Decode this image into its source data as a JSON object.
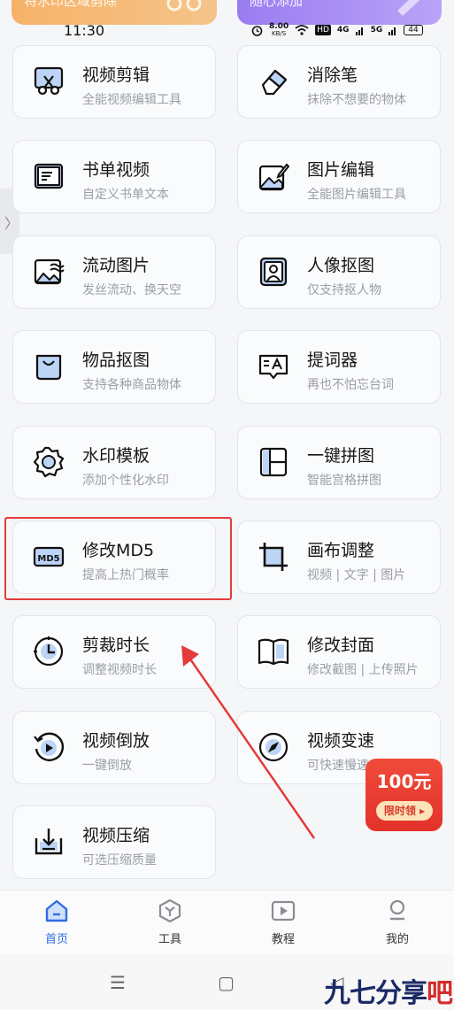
{
  "banners": {
    "left_text": "将水印区域剪除",
    "right_text": "随心添加"
  },
  "status_bar": {
    "time": "11:30",
    "speed_value": "8.00",
    "speed_unit": "KB/S",
    "hd": "HD",
    "signal_1": "4G",
    "signal_2": "5G",
    "battery": "44"
  },
  "side_handle": {
    "glyph": "〉"
  },
  "tools": [
    {
      "title": "视频剪辑",
      "subtitle": "全能视频编辑工具",
      "icon": "scissors-icon"
    },
    {
      "title": "消除笔",
      "subtitle": "抹除不想要的物体",
      "icon": "eraser-icon"
    },
    {
      "title": "书单视频",
      "subtitle": "自定义书单文本",
      "icon": "book-icon"
    },
    {
      "title": "图片编辑",
      "subtitle": "全能图片编辑工具",
      "icon": "image-edit-icon"
    },
    {
      "title": "流动图片",
      "subtitle": "发丝流动、换天空",
      "icon": "flowing-image-icon"
    },
    {
      "title": "人像抠图",
      "subtitle": "仅支持抠人物",
      "icon": "portrait-icon"
    },
    {
      "title": "物品抠图",
      "subtitle": "支持各种商品物体",
      "icon": "bag-icon"
    },
    {
      "title": "提词器",
      "subtitle": "再也不怕忘台词",
      "icon": "teleprompter-icon"
    },
    {
      "title": "水印模板",
      "subtitle": "添加个性化水印",
      "icon": "watermark-gear-icon"
    },
    {
      "title": "一键拼图",
      "subtitle": "智能宫格拼图",
      "icon": "collage-icon"
    },
    {
      "title": "修改MD5",
      "subtitle": "提高上热门概率",
      "icon": "md5-icon",
      "icon_text": "MD5"
    },
    {
      "title": "画布调整",
      "subtitle": "视频 | 文字 | 图片",
      "icon": "crop-icon"
    },
    {
      "title": "剪裁时长",
      "subtitle": "调整视频时长",
      "icon": "clock-icon"
    },
    {
      "title": "修改封面",
      "subtitle": "修改截图 | 上传照片",
      "icon": "cover-book-icon"
    },
    {
      "title": "视频倒放",
      "subtitle": "一键倒放",
      "icon": "reverse-icon"
    },
    {
      "title": "视频变速",
      "subtitle": "可快速慢速",
      "icon": "compass-speed-icon"
    },
    {
      "title": "视频压缩",
      "subtitle": "可选压缩质量",
      "icon": "compress-icon"
    }
  ],
  "promo": {
    "amount": "100元",
    "label": "限时领 ▸"
  },
  "bottom_nav": [
    {
      "label": "首页",
      "icon": "home-icon",
      "active": true
    },
    {
      "label": "工具",
      "icon": "cube-icon",
      "active": false
    },
    {
      "label": "教程",
      "icon": "play-icon",
      "active": false
    },
    {
      "label": "我的",
      "icon": "user-icon",
      "active": false
    }
  ],
  "system_nav": {
    "menu": "☰",
    "home": "▢",
    "back": "◁"
  },
  "watermark": {
    "part1": "九七分享",
    "part2": "吧"
  },
  "colors": {
    "accent": "#2f6de3",
    "highlight": "#e43b3b",
    "icon_fill": "#bcd4f5",
    "promo": "#e2322a"
  }
}
